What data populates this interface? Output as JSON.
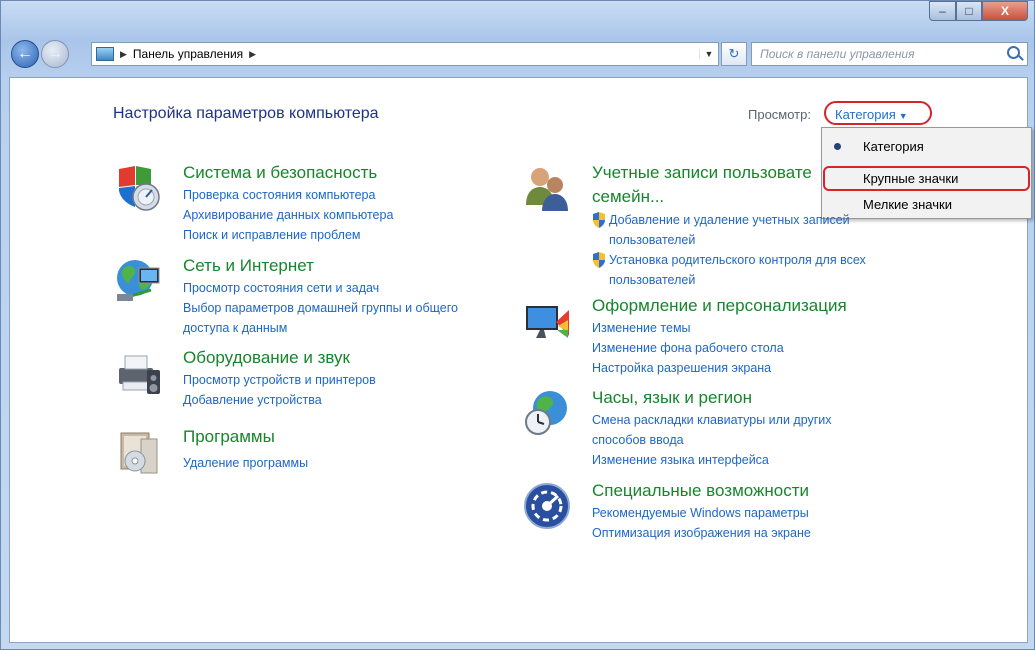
{
  "window": {
    "caption_buttons": {
      "minimize": "–",
      "maximize": "□",
      "close": "X"
    }
  },
  "navbar": {
    "address": {
      "segment": "Панель управления"
    },
    "search": {
      "placeholder": "Поиск в панели управления"
    }
  },
  "page": {
    "title": "Настройка параметров компьютера",
    "view_label": "Просмотр:",
    "view_value": "Категория"
  },
  "view_menu": {
    "items": [
      {
        "label": "Категория",
        "selected": true
      },
      {
        "label": "Крупные значки",
        "highlighted": true
      },
      {
        "label": "Мелкие значки"
      }
    ]
  },
  "categories": {
    "left": [
      {
        "icon": "system-security-icon",
        "title": "Система и безопасность",
        "links": [
          "Проверка состояния компьютера",
          "Архивирование данных компьютера",
          "Поиск и исправление проблем"
        ]
      },
      {
        "icon": "network-icon",
        "title": "Сеть и Интернет",
        "links": [
          "Просмотр состояния сети и задач",
          "Выбор параметров домашней группы и общего",
          "доступа к данным"
        ]
      },
      {
        "icon": "hardware-sound-icon",
        "title": "Оборудование и звук",
        "links": [
          "Просмотр устройств и принтеров",
          "Добавление устройства"
        ]
      },
      {
        "icon": "programs-icon",
        "title": "Программы",
        "links": [
          "Удаление программы"
        ]
      }
    ],
    "right": [
      {
        "icon": "user-accounts-icon",
        "title_line1": "Учетные записи пользовате",
        "title_line2": "семейн...",
        "links": [
          "Добавление и удаление учетных записей",
          "пользователей",
          "Установка родительского контроля для всех",
          "пользователей"
        ]
      },
      {
        "icon": "appearance-icon",
        "title": "Оформление и персонализация",
        "links": [
          "Изменение темы",
          "Изменение фона рабочего стола",
          "Настройка разрешения экрана"
        ]
      },
      {
        "icon": "clock-region-icon",
        "title": "Часы, язык и регион",
        "links": [
          "Смена раскладки клавиатуры или других",
          "способов ввода",
          "Изменение языка интерфейса"
        ]
      },
      {
        "icon": "ease-of-access-icon",
        "title": "Специальные возможности",
        "links": [
          "Рекомендуемые Windows параметры",
          "Оптимизация изображения на экране"
        ]
      }
    ]
  }
}
